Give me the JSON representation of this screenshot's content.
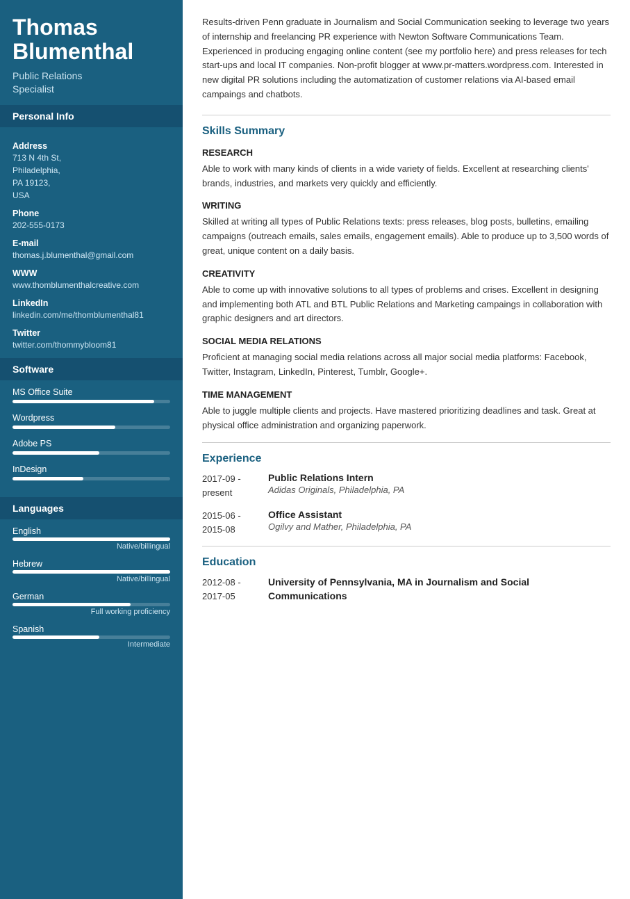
{
  "sidebar": {
    "name": "Thomas Blumenthal",
    "job_title": "Public Relations\nSpecialist",
    "sections": {
      "personal_info_label": "Personal Info",
      "address_label": "Address",
      "address_value": "713 N 4th St,\nPhiladelphia,\nPA 19123,\nUSA",
      "phone_label": "Phone",
      "phone_value": "202-555-0173",
      "email_label": "E-mail",
      "email_value": "thomas.j.blumenthal@gmail.com",
      "www_label": "WWW",
      "www_value": "www.thomblumenthalcreative.com",
      "linkedin_label": "LinkedIn",
      "linkedin_value": "linkedin.com/me/thomblumenthal81",
      "twitter_label": "Twitter",
      "twitter_value": "twitter.com/thommybloom81"
    },
    "software_label": "Software",
    "software": [
      {
        "name": "MS Office Suite",
        "percent": 90
      },
      {
        "name": "Wordpress",
        "percent": 65
      },
      {
        "name": "Adobe PS",
        "percent": 55
      },
      {
        "name": "InDesign",
        "percent": 45
      }
    ],
    "languages_label": "Languages",
    "languages": [
      {
        "name": "English",
        "percent": 100,
        "level": "Native/billingual"
      },
      {
        "name": "Hebrew",
        "percent": 100,
        "level": "Native/billingual"
      },
      {
        "name": "German",
        "percent": 75,
        "level": "Full working proficiency"
      },
      {
        "name": "Spanish",
        "percent": 55,
        "level": "Intermediate"
      }
    ]
  },
  "main": {
    "summary": "Results-driven Penn graduate in Journalism and Social Communication seeking to leverage two years of internship and freelancing PR experience with Newton Software Communications Team. Experienced in producing engaging online content (see my portfolio here) and press releases for tech start-ups and local IT companies. Non-profit blogger at www.pr-matters.wordpress.com. Interested in new digital PR solutions including the automatization of customer relations via AI-based email campaings and chatbots.",
    "skills_title": "Skills Summary",
    "skills": [
      {
        "heading": "RESEARCH",
        "desc": "Able to work with many kinds of clients in a wide variety of fields. Excellent at researching clients' brands, industries, and markets very quickly and efficiently."
      },
      {
        "heading": "WRITING",
        "desc": "Skilled at writing all types of Public Relations texts: press releases, blog posts, bulletins, emailing campaigns (outreach emails, sales emails, engagement emails). Able to produce up to 3,500 words of great, unique content on a daily basis."
      },
      {
        "heading": "CREATIVITY",
        "desc": "Able to come up with innovative solutions to all types of problems and crises. Excellent in designing and implementing both ATL and BTL Public Relations and Marketing campaings in collaboration with graphic designers and art directors."
      },
      {
        "heading": "SOCIAL MEDIA RELATIONS",
        "desc": "Proficient at managing social media relations across all major social media platforms: Facebook, Twitter, Instagram, LinkedIn, Pinterest, Tumblr, Google+."
      },
      {
        "heading": "TIME MANAGEMENT",
        "desc": "Able to juggle multiple clients and projects. Have mastered prioritizing deadlines and task. Great at physical office administration and organizing paperwork."
      }
    ],
    "experience_title": "Experience",
    "experience": [
      {
        "date": "2017-09 -\npresent",
        "title": "Public Relations Intern",
        "company": "Adidas Originals, Philadelphia, PA"
      },
      {
        "date": "2015-06 -\n2015-08",
        "title": "Office Assistant",
        "company": "Ogilvy and Mather, Philadelphia, PA"
      }
    ],
    "education_title": "Education",
    "education": [
      {
        "date": "2012-08 -\n2017-05",
        "title": "University of Pennsylvania, MA in Journalism and Social Communications"
      }
    ]
  }
}
